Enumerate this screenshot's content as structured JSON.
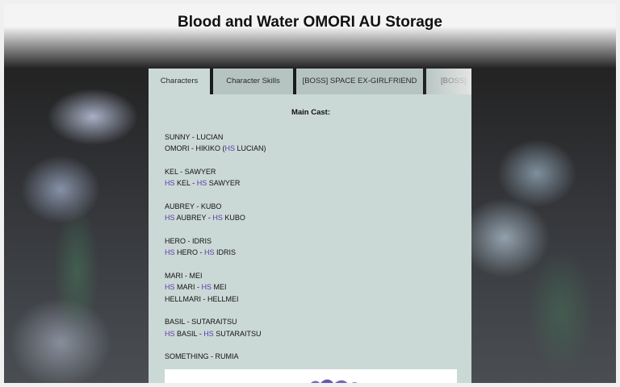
{
  "page": {
    "title": "Blood and Water OMORI AU Storage"
  },
  "tabs": [
    {
      "label": "Characters",
      "active": true
    },
    {
      "label": "Character Skills",
      "active": false
    },
    {
      "label": "[BOSS] SPACE EX-GIRLFRIEND",
      "active": false
    },
    {
      "label": "[BOSS]",
      "active": false
    }
  ],
  "content": {
    "heading": "Main Cast:",
    "hs_prefix": "HS",
    "groups": [
      {
        "lines": [
          {
            "text": "SUNNY - LUCIAN"
          },
          {
            "text": "OMORI - HIKIKO (",
            "hs": "HS",
            "rest": " LUCIAN)"
          }
        ]
      },
      {
        "lines": [
          {
            "text": "KEL - SAWYER"
          },
          {
            "hs": "HS",
            "rest": " KEL - ",
            "hs2": "HS",
            "rest2": " SAWYER"
          }
        ]
      },
      {
        "lines": [
          {
            "text": "AUBREY - KUBO"
          },
          {
            "hs": "HS",
            "rest": " AUBREY - ",
            "hs2": "HS",
            "rest2": " KUBO"
          }
        ]
      },
      {
        "lines": [
          {
            "text": "HERO - IDRIS"
          },
          {
            "hs": "HS",
            "rest": " HERO - ",
            "hs2": "HS",
            "rest2": " IDRIS"
          }
        ]
      },
      {
        "lines": [
          {
            "text": "MARI - MEI"
          },
          {
            "hs": "HS",
            "rest": " MARI - ",
            "hs2": "HS",
            "rest2": " MEI"
          },
          {
            "text": "HELLMARI - HELLMEI"
          }
        ]
      },
      {
        "lines": [
          {
            "text": "BASIL - SUTARAITSU"
          },
          {
            "hs": "HS",
            "rest": " BASIL - ",
            "hs2": "HS",
            "rest2": " SUTARAITSU"
          }
        ]
      },
      {
        "lines": [
          {
            "text": "SOMETHING - RUMIA"
          }
        ]
      }
    ]
  },
  "colors": {
    "panel": "#cbd9d6",
    "tab": "#b6c4c1",
    "hs": "#5b3aa6"
  }
}
